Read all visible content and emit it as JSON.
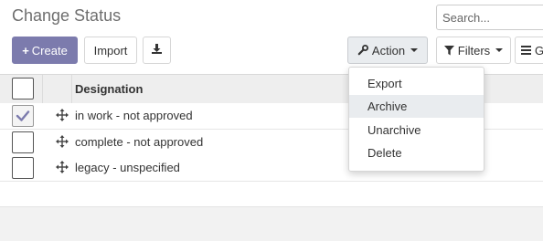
{
  "header": {
    "title": "Change Status"
  },
  "search": {
    "placeholder": "Search..."
  },
  "toolbar": {
    "create_label": "Create",
    "import_label": "Import",
    "action_label": "Action",
    "filters_label": "Filters",
    "group_label": "G"
  },
  "table": {
    "column_header": "Designation",
    "rows": [
      {
        "label": "in work - not approved",
        "selected": true
      },
      {
        "label": "complete - not approved",
        "selected": false
      },
      {
        "label": "legacy - unspecified",
        "selected": false
      }
    ]
  },
  "action_menu": {
    "items": [
      {
        "label": "Export"
      },
      {
        "label": "Archive",
        "highlighted": true
      },
      {
        "label": "Unarchive"
      },
      {
        "label": "Delete"
      }
    ]
  },
  "colors": {
    "primary": "#7c7bad",
    "menu_highlight": "#e9ecef"
  }
}
